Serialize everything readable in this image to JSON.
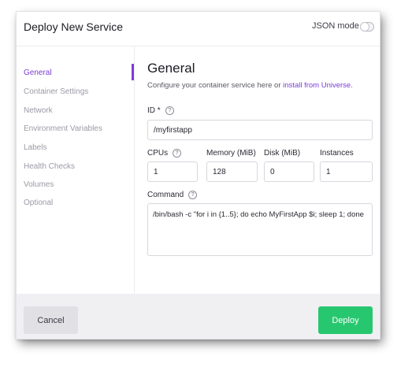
{
  "header": {
    "title": "Deploy New Service",
    "json_mode_label": "JSON mode"
  },
  "sidebar": {
    "items": [
      {
        "label": "General"
      },
      {
        "label": "Container Settings"
      },
      {
        "label": "Network"
      },
      {
        "label": "Environment Variables"
      },
      {
        "label": "Labels"
      },
      {
        "label": "Health Checks"
      },
      {
        "label": "Volumes"
      },
      {
        "label": "Optional"
      }
    ]
  },
  "main": {
    "title": "General",
    "description": "Configure your container service here or ",
    "description_link": "install from Universe",
    "description_end": ".",
    "id": {
      "label": "ID *",
      "value": "/myfirstapp"
    },
    "cpus": {
      "label": "CPUs",
      "value": "1"
    },
    "memory": {
      "label": "Memory (MiB)",
      "value": "128"
    },
    "disk": {
      "label": "Disk (MiB)",
      "value": "0"
    },
    "instances": {
      "label": "Instances",
      "value": "1"
    },
    "command": {
      "label": "Command",
      "value": "/bin/bash -c \"for i in {1..5}; do echo MyFirstApp $i; sleep 1; done"
    }
  },
  "footer": {
    "cancel_label": "Cancel",
    "deploy_label": "Deploy"
  },
  "help_glyph": "?",
  "colors": {
    "accent": "#7c3dd6",
    "deploy": "#27c76f"
  }
}
